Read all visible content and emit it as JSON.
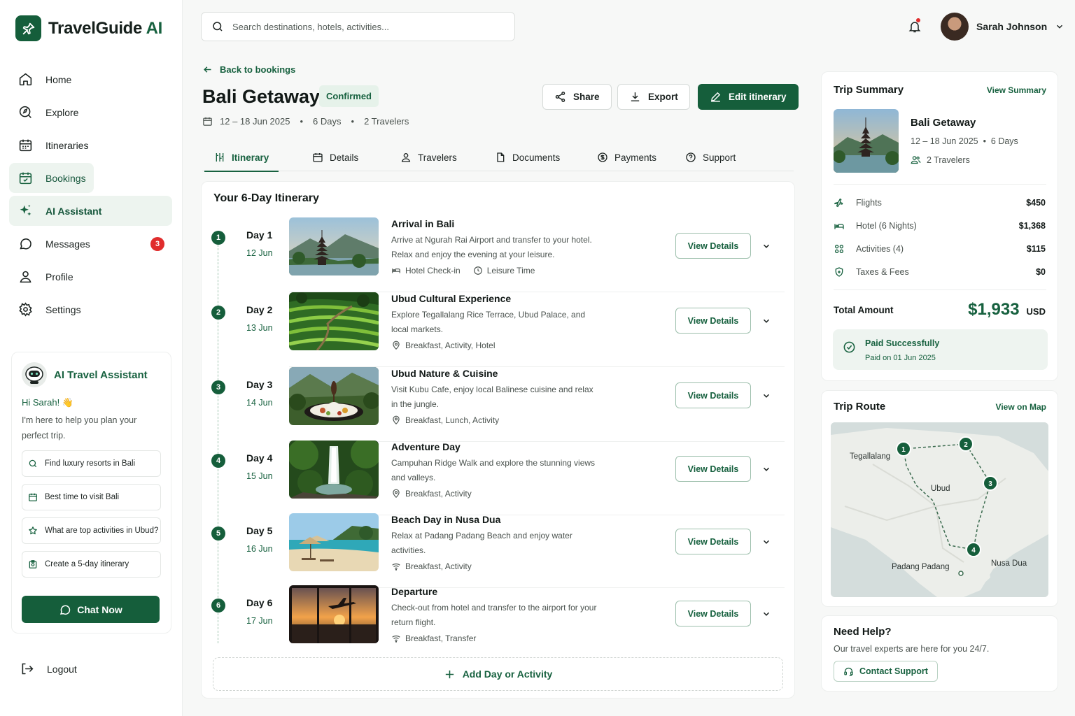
{
  "app": {
    "name": "TravelGuide",
    "name_ai": "AI"
  },
  "search": {
    "placeholder": "Search destinations, hotels, activities..."
  },
  "user": {
    "name": "Sarah Johnson"
  },
  "nav": {
    "items": [
      {
        "label": "Home",
        "icon": "home-icon"
      },
      {
        "label": "Explore",
        "icon": "explore-icon"
      },
      {
        "label": "Itineraries",
        "icon": "calendar-icon"
      },
      {
        "label": "Bookings",
        "icon": "bookings-icon"
      },
      {
        "label": "AI Assistant",
        "icon": "sparkle-icon"
      },
      {
        "label": "Messages",
        "icon": "message-icon",
        "badge": "3"
      },
      {
        "label": "Profile",
        "icon": "user-icon"
      },
      {
        "label": "Settings",
        "icon": "gear-icon"
      }
    ],
    "logout": "Logout"
  },
  "assistant": {
    "title": "AI Travel Assistant",
    "greeting": "Hi Sarah! 👋",
    "intro": "I'm here to help you plan your perfect trip.",
    "suggestions": [
      "Find luxury resorts in Bali",
      "Best time to visit Bali",
      "What are top activities in Ubud?",
      "Create a 5-day itinerary"
    ],
    "chat_label": "Chat Now"
  },
  "trip": {
    "back_label": "Back to bookings",
    "title": "Bali Getaway",
    "status": "Confirmed",
    "dates": "12 – 18 Jun 2025",
    "days": "6 Days",
    "travelers": "2 Travelers",
    "actions": {
      "share": "Share",
      "export": "Export",
      "edit": "Edit itinerary"
    }
  },
  "tabs": [
    "Itinerary",
    "Details",
    "Travelers",
    "Documents",
    "Payments",
    "Support"
  ],
  "itinerary": {
    "heading": "Your 6-Day Itinerary",
    "view_details": "View Details",
    "add_label": "Add Day or Activity",
    "days": [
      {
        "num": "1",
        "label": "Day 1",
        "date": "12 Jun",
        "title": "Arrival in Bali",
        "desc": "Arrive at Ngurah Rai Airport and transfer to your hotel. Relax and enjoy the evening at your leisure.",
        "tags": [
          "Hotel Check-in",
          "Leisure Time"
        ]
      },
      {
        "num": "2",
        "label": "Day 2",
        "date": "13 Jun",
        "title": "Ubud Cultural Experience",
        "desc": "Explore Tegallalang Rice Terrace, Ubud Palace, and local markets.",
        "tags": [
          "Breakfast, Activity, Hotel"
        ]
      },
      {
        "num": "3",
        "label": "Day 3",
        "date": "14 Jun",
        "title": "Ubud Nature & Cuisine",
        "desc": "Visit Kubu Cafe, enjoy local Balinese cuisine and relax in the jungle.",
        "tags": [
          "Breakfast, Lunch, Activity"
        ]
      },
      {
        "num": "4",
        "label": "Day 4",
        "date": "15 Jun",
        "title": "Adventure Day",
        "desc": "Campuhan Ridge Walk and explore the stunning views and valleys.",
        "tags": [
          "Breakfast, Activity"
        ]
      },
      {
        "num": "5",
        "label": "Day 5",
        "date": "16 Jun",
        "title": "Beach Day in Nusa Dua",
        "desc": "Relax at Padang Padang Beach and enjoy water activities.",
        "tags": [
          "Breakfast, Activity"
        ]
      },
      {
        "num": "6",
        "label": "Day 6",
        "date": "17 Jun",
        "title": "Departure",
        "desc": "Check-out from hotel and transfer to the airport for your return flight.",
        "tags": [
          "Breakfast, Transfer"
        ]
      }
    ]
  },
  "summary": {
    "heading": "Trip Summary",
    "link": "View Summary",
    "name": "Bali Getaway",
    "dates": "12 – 18 Jun 2025",
    "days": "6 Days",
    "travelers": "2 Travelers",
    "costs": [
      {
        "label": "Flights",
        "amount": "$450",
        "icon": "plane-icon"
      },
      {
        "label": "Hotel (6 Nights)",
        "amount": "$1,368",
        "icon": "bed-icon"
      },
      {
        "label": "Activities (4)",
        "amount": "$115",
        "icon": "activities-icon"
      },
      {
        "label": "Taxes & Fees",
        "amount": "$0",
        "icon": "tax-icon"
      }
    ],
    "total_label": "Total Amount",
    "total": "$1,933",
    "currency": "USD",
    "paid_title": "Paid Successfully",
    "paid_sub": "Paid on 01 Jun 2025"
  },
  "route": {
    "heading": "Trip Route",
    "link": "View on Map",
    "places": [
      "Tegallalang",
      "Ubud",
      "Padang Padang",
      "Nusa Dua"
    ],
    "stops": [
      "1",
      "2",
      "3",
      "4"
    ]
  },
  "help": {
    "heading": "Need Help?",
    "text": "Our travel experts are here for you 24/7.",
    "button": "Contact Support"
  },
  "colors": {
    "brand": "#155e3b",
    "accent_light": "#edf4ef",
    "badge": "#e02d2d"
  }
}
